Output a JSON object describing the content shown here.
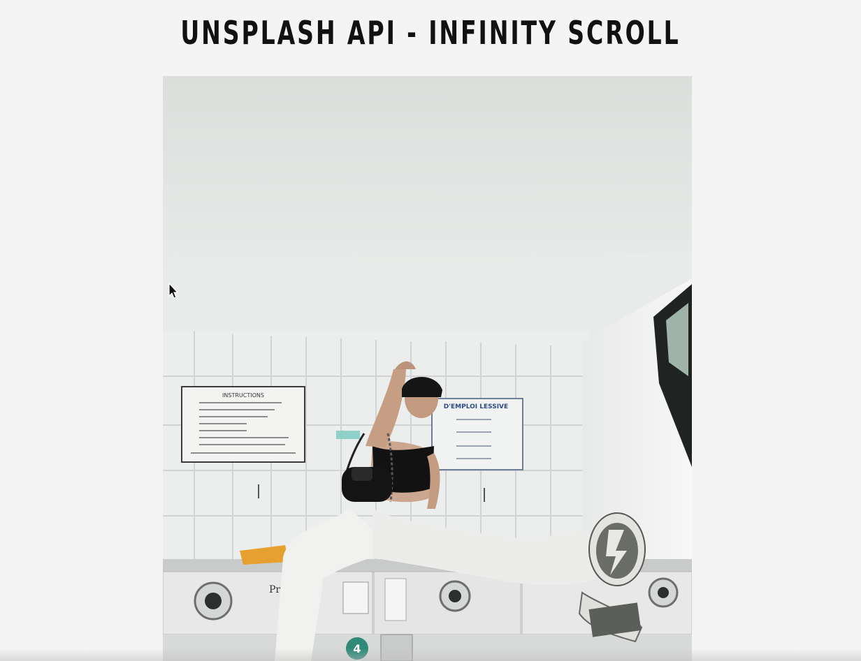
{
  "page": {
    "title": "UNSPLASH API - INFINITY SCROLL"
  },
  "photo": {
    "poster_left_title": "INSTRUCTIONS",
    "poster_right_title": "D'EMPLOI LESSIVE",
    "machine_brand": "Pri",
    "machine_number": "4"
  },
  "colors": {
    "background": "#f4f4f4",
    "title": "#111111"
  }
}
